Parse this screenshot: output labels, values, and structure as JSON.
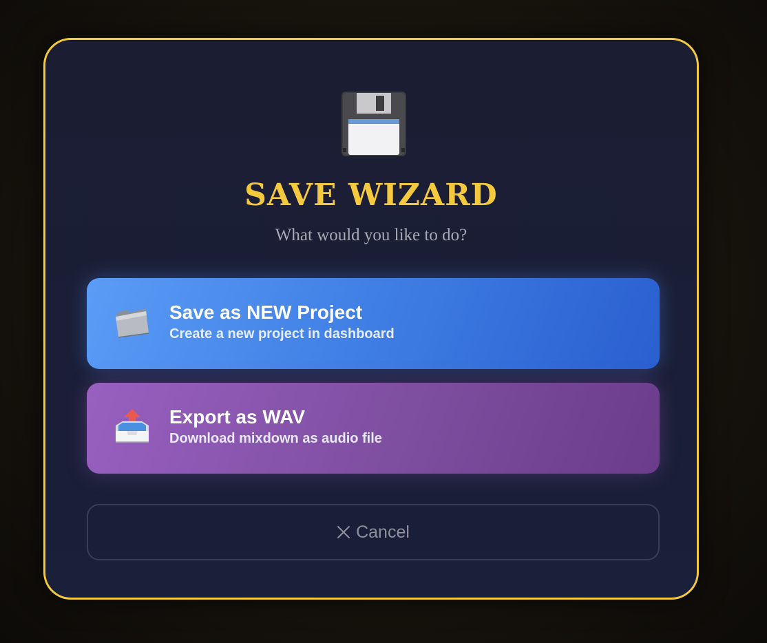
{
  "wizard": {
    "title": "SAVE WIZARD",
    "subtitle": "What would you like to do?",
    "header_icon": "floppy-disk-icon"
  },
  "options": [
    {
      "icon": "folder-icon",
      "title": "Save as NEW Project",
      "description": "Create a new project in dashboard"
    },
    {
      "icon": "outbox-tray-icon",
      "title": "Export as WAV",
      "description": "Download mixdown as audio file"
    }
  ],
  "cancel": {
    "icon": "close-icon",
    "label": "Cancel"
  },
  "colors": {
    "accent": "#f5c93e",
    "modal_bg": "#1a1f3a",
    "new_project": "#3f7ee4",
    "export_wav": "#7e4ea0"
  }
}
